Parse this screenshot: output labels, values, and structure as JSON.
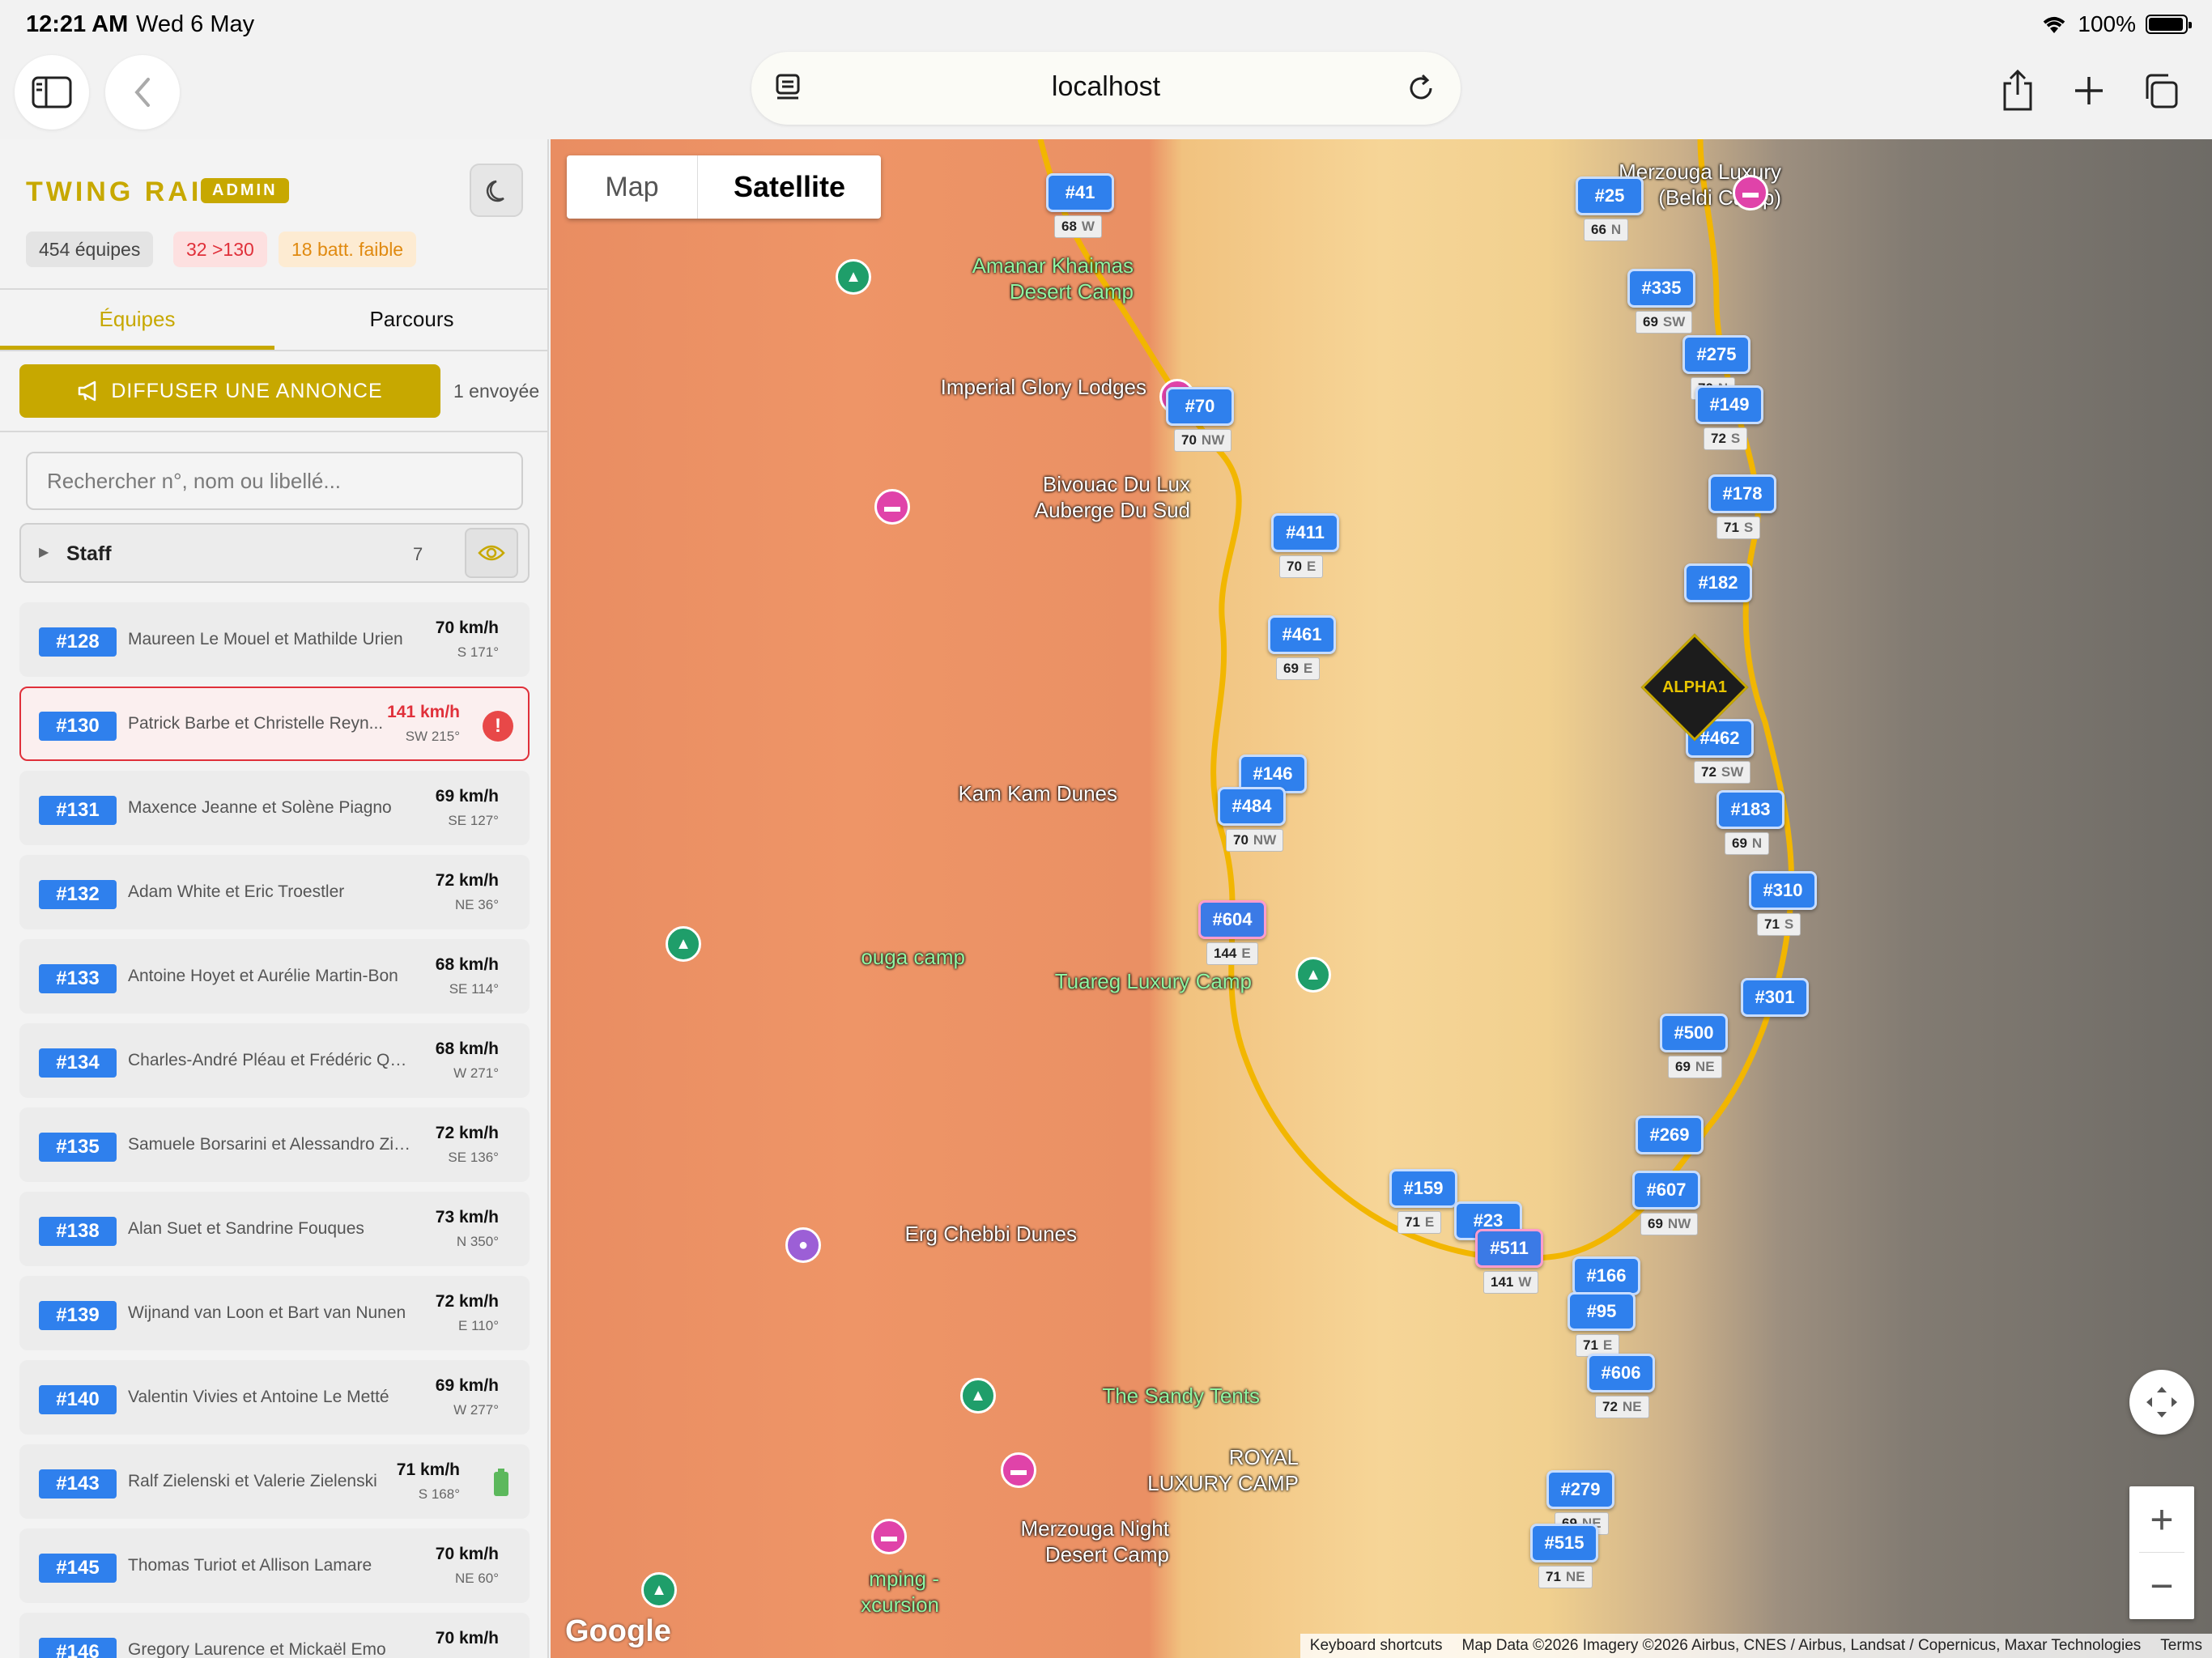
{
  "status_bar": {
    "time": "12:21 AM",
    "date": "Wed 6 May",
    "battery": "100%"
  },
  "browser": {
    "url": "localhost"
  },
  "sidebar": {
    "brand": "TWING RAID",
    "role_badge": "ADMIN",
    "stats": {
      "teams": "454 équipes",
      "over_speed": "32 >130",
      "low_battery": "18 batt. faible"
    },
    "tabs": [
      "Équipes",
      "Parcours"
    ],
    "announce_label": "DIFFUSER UNE ANNONCE",
    "announce_count": "1 envoyée",
    "search_placeholder": "Rechercher n°, nom ou libellé...",
    "staff": {
      "label": "Staff",
      "count": "7"
    },
    "teams": [
      {
        "num": "#128",
        "name": "Maureen Le Mouel et Mathilde Urien",
        "speed": "70 km/h",
        "heading": "S 171°"
      },
      {
        "num": "#130",
        "name": "Patrick Barbe et Christelle Reyn...",
        "speed": "141 km/h",
        "heading": "SW 215°",
        "alert": "!"
      },
      {
        "num": "#131",
        "name": "Maxence Jeanne et Solène Piagno",
        "speed": "69 km/h",
        "heading": "SE 127°"
      },
      {
        "num": "#132",
        "name": "Adam White et Eric Troestler",
        "speed": "72 km/h",
        "heading": "NE 36°"
      },
      {
        "num": "#133",
        "name": "Antoine Hoyet et Aurélie Martin-Bon",
        "speed": "68 km/h",
        "heading": "SE 114°"
      },
      {
        "num": "#134",
        "name": "Charles-André Pléau et Frédéric Quei...",
        "speed": "68 km/h",
        "heading": "W 271°"
      },
      {
        "num": "#135",
        "name": "Samuele Borsarini et Alessandro Ziliani",
        "speed": "72 km/h",
        "heading": "SE 136°"
      },
      {
        "num": "#138",
        "name": "Alan Suet et Sandrine Fouques",
        "speed": "73 km/h",
        "heading": "N 350°"
      },
      {
        "num": "#139",
        "name": "Wijnand van Loon et Bart van Nunen",
        "speed": "72 km/h",
        "heading": "E 110°"
      },
      {
        "num": "#140",
        "name": "Valentin Vivies et Antoine Le Metté",
        "speed": "69 km/h",
        "heading": "W 277°"
      },
      {
        "num": "#143",
        "name": "Ralf Zielenski et Valerie Zielenski",
        "speed": "71 km/h",
        "heading": "S 168°",
        "low_battery": true
      },
      {
        "num": "#145",
        "name": "Thomas Turiot et Allison Lamare",
        "speed": "70 km/h",
        "heading": "NE 60°"
      },
      {
        "num": "#146",
        "name": "Gregory Laurence et Mickaël Emo",
        "speed": "70 km/h",
        "heading": ""
      }
    ]
  },
  "map": {
    "toggle": {
      "map": "Map",
      "satellite": "Satellite"
    },
    "pois": [
      {
        "name": "Merzouga Luxury\n(Beldi Camp)",
        "type": "hotel"
      },
      {
        "name": "Amanar Khaimas\nDesert Camp",
        "type": "camp"
      },
      {
        "name": "Imperial Glory Lodges",
        "type": "hotel"
      },
      {
        "name": "Bivouac Du Lux\nAuberge Du Sud",
        "type": "hotel"
      },
      {
        "name": "Kam Kam Dunes",
        "type": "hotel"
      },
      {
        "name": "ouga camp",
        "type": "camp"
      },
      {
        "name": "Tuareg Luxury Camp",
        "type": "camp"
      },
      {
        "name": "Erg Chebbi Dunes",
        "type": "photo"
      },
      {
        "name": "The Sandy Tents",
        "type": "camp"
      },
      {
        "name": "ROYAL\nLUXURY CAMP",
        "type": "hotel"
      },
      {
        "name": "Merzouga Night\nDesert Camp",
        "type": "hotel"
      },
      {
        "name": "mping -\nxcursion",
        "type": "camp"
      }
    ],
    "markers": [
      {
        "num": "#41",
        "speed": "68",
        "dir": "W"
      },
      {
        "num": "#25",
        "speed": "66",
        "dir": "N"
      },
      {
        "num": "#335",
        "speed": "69",
        "dir": "SW"
      },
      {
        "num": "#275",
        "speed": "70",
        "dir": "N"
      },
      {
        "num": "#149",
        "speed": "72",
        "dir": "S"
      },
      {
        "num": "#70",
        "speed": "70",
        "dir": "NW"
      },
      {
        "num": "#178",
        "speed": "71",
        "dir": "S"
      },
      {
        "num": "#411",
        "speed": "70",
        "dir": "E"
      },
      {
        "num": "#182",
        "speed": "",
        "dir": ""
      },
      {
        "num": "#461",
        "speed": "69",
        "dir": "E"
      },
      {
        "num": "#146",
        "speed": "",
        "dir": ""
      },
      {
        "num": "#484",
        "speed": "70",
        "dir": "NW"
      },
      {
        "num": "#462",
        "speed": "72",
        "dir": "SW"
      },
      {
        "num": "#183",
        "speed": "69",
        "dir": "N"
      },
      {
        "num": "#310",
        "speed": "71",
        "dir": "S"
      },
      {
        "num": "#604",
        "speed": "144",
        "dir": "E"
      },
      {
        "num": "#301",
        "speed": "",
        "dir": ""
      },
      {
        "num": "#500",
        "speed": "69",
        "dir": "NE"
      },
      {
        "num": "#269",
        "speed": "",
        "dir": ""
      },
      {
        "num": "#159",
        "speed": "71",
        "dir": "E"
      },
      {
        "num": "#607",
        "speed": "69",
        "dir": "NW"
      },
      {
        "num": "#23",
        "speed": "",
        "dir": ""
      },
      {
        "num": "#511",
        "speed": "141",
        "dir": "W"
      },
      {
        "num": "#166",
        "speed": "72",
        "dir": "NE"
      },
      {
        "num": "#95",
        "speed": "71",
        "dir": "E"
      },
      {
        "num": "#606",
        "speed": "72",
        "dir": "NE"
      },
      {
        "num": "#279",
        "speed": "69",
        "dir": "NE"
      },
      {
        "num": "#515",
        "speed": "71",
        "dir": "NE"
      }
    ],
    "alpha_label": "ALPHA1",
    "google": "Google",
    "attribution": [
      "Keyboard shortcuts",
      "Map Data ©2026 Imagery ©2026 Airbus, CNES / Airbus, Landsat / Copernicus, Maxar Technologies",
      "Terms"
    ]
  }
}
